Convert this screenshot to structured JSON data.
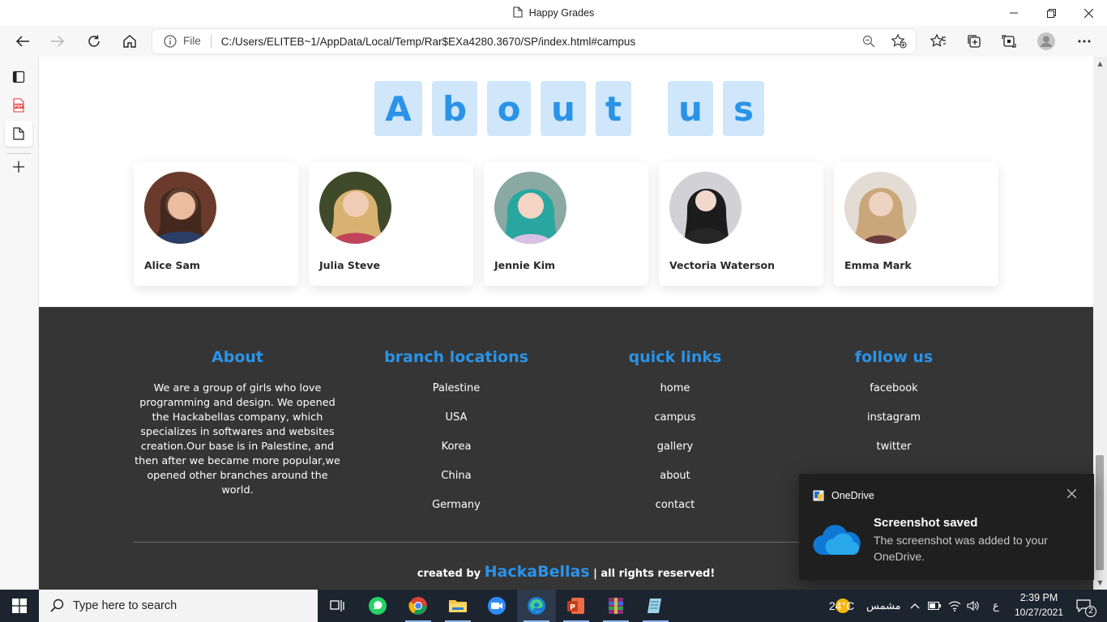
{
  "window": {
    "title": "Happy Grades"
  },
  "toolbar": {
    "file_label": "File",
    "url": "C:/Users/ELITEB~1/AppData/Local/Temp/Rar$EXa4280.3670/SP/index.html#campus"
  },
  "page": {
    "about_letters": [
      "A",
      "b",
      "o",
      "u",
      "t",
      "u",
      "s"
    ],
    "team": [
      {
        "name": "Alice Sam",
        "avatar_color": "#8a5a44"
      },
      {
        "name": "Julia Steve",
        "avatar_color": "#b9884c"
      },
      {
        "name": "Jennie Kim",
        "avatar_color": "#4fb7b0"
      },
      {
        "name": "Vectoria Waterson",
        "avatar_color": "#2b2b2b"
      },
      {
        "name": "Emma Mark",
        "avatar_color": "#c9ab86"
      }
    ],
    "footer": {
      "about": {
        "heading": "About",
        "text": "We are a group of girls who love programming and design. We opened the Hackabellas company, which specializes in softwares and websites creation.Our base is in Palestine, and then after we became more popular,we opened other branches around the world."
      },
      "branches": {
        "heading": "branch locations",
        "items": [
          "Palestine",
          "USA",
          "Korea",
          "China",
          "Germany"
        ]
      },
      "quick_links": {
        "heading": "quick links",
        "items": [
          "home",
          "campus",
          "gallery",
          "about",
          "contact"
        ]
      },
      "follow": {
        "heading": "follow us",
        "items": [
          "facebook",
          "instagram",
          "twitter"
        ]
      },
      "credit": {
        "prefix": "created by",
        "brand": "HackaBellas",
        "suffix": "| all rights reserved!"
      }
    }
  },
  "toast": {
    "app": "OneDrive",
    "headline": "Screenshot saved",
    "body": "The screenshot was added to your OneDrive."
  },
  "taskbar": {
    "search_placeholder": "Type here to search",
    "weather": "24°C",
    "weather_label": "مشمس",
    "lang": "ع",
    "time": "2:39 PM",
    "date": "10/27/2021",
    "notifications": "2"
  },
  "colors": {
    "accent": "#2a93e8",
    "footer_bg": "#353535",
    "letter_bg": "#cfe6fb"
  }
}
